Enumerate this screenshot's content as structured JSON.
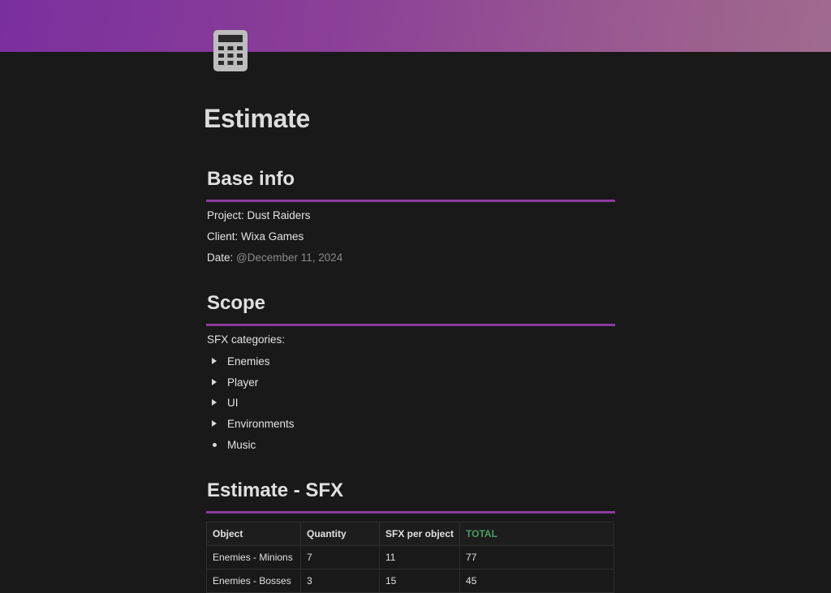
{
  "page": {
    "title": "Estimate"
  },
  "colors": {
    "accent_rule": "#8e3a9f",
    "total_header": "#4a9c66"
  },
  "page_icon": "calculator-icon",
  "base_info": {
    "heading": "Base info",
    "project": "Project: Dust Raiders",
    "client": "Client: Wixa Games",
    "date_label": "Date: ",
    "date_value": "@December 11, 2024"
  },
  "scope": {
    "heading": "Scope",
    "intro": "SFX categories:",
    "items": [
      {
        "label": "Enemies",
        "kind": "toggle"
      },
      {
        "label": "Player",
        "kind": "toggle"
      },
      {
        "label": "UI",
        "kind": "toggle"
      },
      {
        "label": "Environments",
        "kind": "toggle"
      },
      {
        "label": "Music",
        "kind": "bullet"
      }
    ]
  },
  "estimate_sfx": {
    "heading": "Estimate - SFX",
    "columns": [
      "Object",
      "Quantity",
      "SFX per object",
      "TOTAL"
    ],
    "rows": [
      [
        "Enemies - Minions",
        "7",
        "11",
        "77"
      ],
      [
        "Enemies - Bosses",
        "3",
        "15",
        "45"
      ]
    ]
  }
}
